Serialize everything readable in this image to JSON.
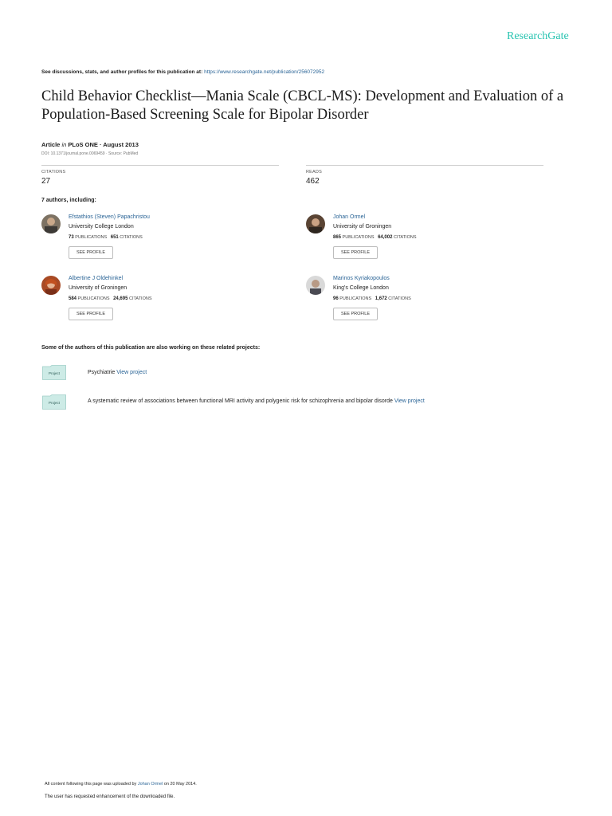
{
  "header": {
    "logo": "ResearchGate"
  },
  "discussion": {
    "prefix": "See discussions, stats, and author profiles for this publication at:",
    "url": "https://www.researchgate.net/publication/256072952"
  },
  "publication": {
    "title": "Child Behavior Checklist—Mania Scale (CBCL-MS): Development and Evaluation of a Population-Based Screening Scale for Bipolar Disorder",
    "type": "Article",
    "in_word": "in",
    "journal_date": "PLoS ONE · August 2013",
    "doi": "DOI: 10.1371/journal.pone.0069459 · Source: PubMed"
  },
  "stats": {
    "citations_label": "CITATIONS",
    "citations_value": "27",
    "reads_label": "READS",
    "reads_value": "462"
  },
  "authors_heading": "7 authors, including:",
  "authors": [
    {
      "name": "Efstathios (Steven) Papachristou",
      "institution": "University College London",
      "publications": "73",
      "publications_label": "PUBLICATIONS",
      "citations": "651",
      "citations_label": "CITATIONS",
      "button": "SEE PROFILE"
    },
    {
      "name": "Johan Ormel",
      "institution": "University of Groningen",
      "publications": "865",
      "publications_label": "PUBLICATIONS",
      "citations": "64,002",
      "citations_label": "CITATIONS",
      "button": "SEE PROFILE"
    },
    {
      "name": "Albertine J Oldehinkel",
      "institution": "University of Groningen",
      "publications": "584",
      "publications_label": "PUBLICATIONS",
      "citations": "24,695",
      "citations_label": "CITATIONS",
      "button": "SEE PROFILE"
    },
    {
      "name": "Marinos Kyriakopoulos",
      "institution": "King's College London",
      "publications": "96",
      "publications_label": "PUBLICATIONS",
      "citations": "1,672",
      "citations_label": "CITATIONS",
      "button": "SEE PROFILE"
    }
  ],
  "projects_heading": "Some of the authors of this publication are also working on these related projects:",
  "projects": [
    {
      "folder_label": "Project",
      "title": "Psychiatrie",
      "link": "View project"
    },
    {
      "folder_label": "Project",
      "title": "A systematic review of associations between functional MRI activity and polygenic risk for schizophrenia and bipolar disorde",
      "link": "View project"
    }
  ],
  "footer": {
    "uploaded_prefix": "All content following this page was uploaded by",
    "uploader": "Johan Ormel",
    "uploaded_suffix": "on 20 May 2014.",
    "enhancement": "The user has requested enhancement of the downloaded file."
  },
  "colors": {
    "brand": "#29c4b1",
    "link": "#2a6496",
    "folder": "#cdebe6"
  }
}
